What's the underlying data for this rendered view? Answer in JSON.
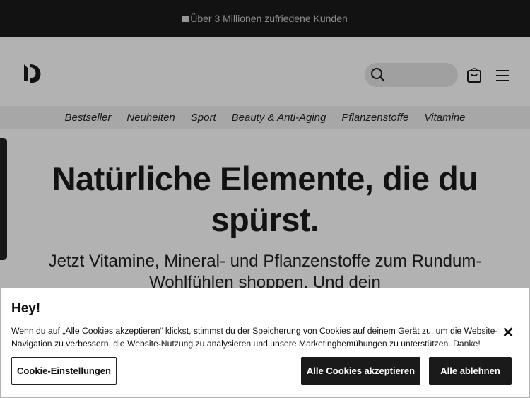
{
  "announcement": {
    "text": "Über 3 Millionen zufriedene Kunden"
  },
  "header": {
    "logo_icon": "brand-logo-icon",
    "search_icon": "search-icon",
    "cart_icon": "shopping-bag-icon",
    "menu_icon": "hamburger-menu-icon"
  },
  "nav": {
    "items": [
      "Bestseller",
      "Neuheiten",
      "Sport",
      "Beauty & Anti-Aging",
      "Pflanzenstoffe",
      "Vitamine"
    ]
  },
  "hero": {
    "title": "Natürliche Elemente, die du spürst.",
    "subtitle": "Jetzt Vitamine, Mineral- und Pflanzenstoffe zum Rundum-Wohlfühlen shoppen. Und dein"
  },
  "cookie_banner": {
    "title": "Hey!",
    "text": "Wenn du auf „Alle Cookies akzeptieren“ klickst, stimmst du der Speicherung von Cookies auf deinem Gerät zu, um die Website-Navigation zu verbessern, die Website-Nutzung zu analysieren und unsere Marketingbemühungen zu unterstützen. Danke!",
    "close_icon": "close-icon",
    "settings_label": "Cookie-Einstellungen",
    "accept_label": "Alle Cookies akzeptieren",
    "reject_label": "Alle ablehnen"
  },
  "colors": {
    "topbar_bg": "#1b1b1b",
    "button_dark": "#1a1a1a",
    "nav_bg": "#efefef"
  }
}
